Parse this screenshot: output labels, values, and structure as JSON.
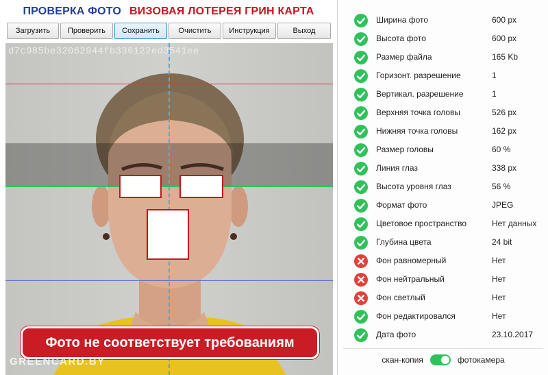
{
  "header": {
    "title_left": "ПРОВЕРКА ФОТО",
    "title_right": "ВИЗОВАЯ ЛОТЕРЕЯ ГРИН КАРТА"
  },
  "toolbar": [
    {
      "label": "Загрузить"
    },
    {
      "label": "Проверить"
    },
    {
      "label": "Сохранить"
    },
    {
      "label": "Очистить"
    },
    {
      "label": "Инструкция"
    },
    {
      "label": "Выход"
    }
  ],
  "photo": {
    "hash": "d7c985be32062944fb336122ed3541ee",
    "warning": "Фото не соответствует требованиям",
    "watermark": "GREENCARD.BY"
  },
  "checks": [
    {
      "label": "Ширина фото",
      "value": "600 px",
      "status": "ok"
    },
    {
      "label": "Высота фото",
      "value": "600 px",
      "status": "ok"
    },
    {
      "label": "Размер файла",
      "value": "165 Kb",
      "status": "ok"
    },
    {
      "label": "Горизонт. разрешение",
      "value": "1",
      "status": "ok"
    },
    {
      "label": "Вертикал. разрешение",
      "value": "1",
      "status": "ok"
    },
    {
      "label": "Верхняя точка головы",
      "value": "526 px",
      "status": "ok"
    },
    {
      "label": "Нижняя точка головы",
      "value": "162 px",
      "status": "ok"
    },
    {
      "label": "Размер головы",
      "value": "60 %",
      "status": "ok"
    },
    {
      "label": "Линия глаз",
      "value": "338 px",
      "status": "ok"
    },
    {
      "label": "Высота уровня глаз",
      "value": "56 %",
      "status": "ok"
    },
    {
      "label": "Формат фото",
      "value": "JPEG",
      "status": "ok"
    },
    {
      "label": "Цветовое пространство",
      "value": "Нет данных",
      "status": "ok"
    },
    {
      "label": "Глубина цвета",
      "value": "24 bit",
      "status": "ok"
    },
    {
      "label": "Фон равномерный",
      "value": "Нет",
      "status": "fail"
    },
    {
      "label": "Фон нейтральный",
      "value": "Нет",
      "status": "fail"
    },
    {
      "label": "Фон светлый",
      "value": "Нет",
      "status": "fail"
    },
    {
      "label": "Фон редактировался",
      "value": "Нет",
      "status": "ok"
    },
    {
      "label": "Дата фото",
      "value": "23.10.2017",
      "status": "ok"
    }
  ],
  "source_switch": {
    "left_label": "скан-копия",
    "right_label": "фотокамера",
    "selected": "фотокамера"
  },
  "colors": {
    "ok": "#2fc25b",
    "fail": "#e0413a",
    "title_blue": "#1f3f9c",
    "title_red": "#c8141e",
    "warning_bg": "#c81d25"
  }
}
